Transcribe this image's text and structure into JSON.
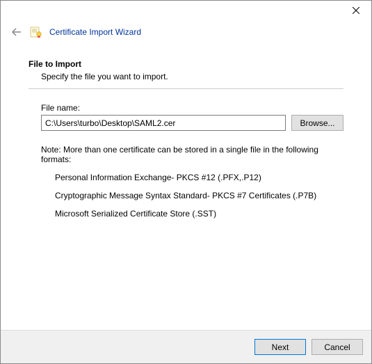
{
  "window": {
    "title": "Certificate Import Wizard"
  },
  "page": {
    "heading": "File to Import",
    "description": "Specify the file you want to import."
  },
  "file": {
    "label": "File name:",
    "value": "C:\\Users\\turbo\\Desktop\\SAML2.cer",
    "browse_label": "Browse..."
  },
  "note": {
    "intro": "Note:  More than one certificate can be stored in a single file in the following formats:",
    "formats": [
      "Personal Information Exchange- PKCS #12 (.PFX,.P12)",
      "Cryptographic Message Syntax Standard- PKCS #7 Certificates (.P7B)",
      "Microsoft Serialized Certificate Store (.SST)"
    ]
  },
  "footer": {
    "next_label": "Next",
    "cancel_label": "Cancel"
  }
}
